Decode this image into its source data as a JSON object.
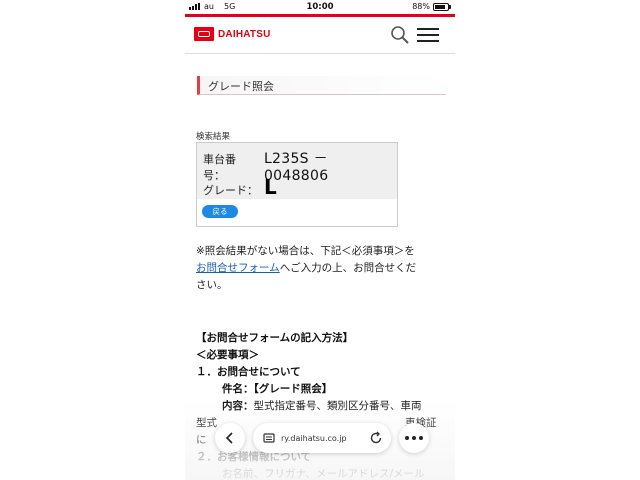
{
  "status_bar": {
    "carrier": "au",
    "network": "5G",
    "time": "10:00",
    "battery": "88%"
  },
  "header": {
    "logo_text": "DAIHATSU",
    "icons": [
      "search-icon",
      "menu-icon"
    ]
  },
  "section": {
    "title": "グレード照会"
  },
  "result": {
    "label": "検索結果",
    "chassis_label": "車台番号：",
    "chassis_value": "L235S － 0048806",
    "grade_label": "グレード：",
    "grade_value": "L",
    "back_button": "戻る"
  },
  "note": {
    "line1": "※照会結果がない場合は、下記＜必須事項＞を",
    "link": "お問合せフォーム",
    "line2": "へご入力の上、お問合せくだ",
    "line3": "さい。"
  },
  "howto": {
    "heading": "【お問合せフォームの記入方法】",
    "required": "＜必要事項＞",
    "item1": "１．お問合せについて",
    "subject": "件名：【グレード照会】",
    "content_label": "内容：",
    "content_text": "型式指定番号、類別区分番号、車両",
    "line_partial1": "型式",
    "line_partial2": "に",
    "line_partial3": "車検証",
    "item2": "２．お客様情報について",
    "item2_detail": "お名前、フリガナ、メールアドレス/メール"
  },
  "toolbar": {
    "url": "ry.daihatsu.co.jp",
    "icons": [
      "back-chevron-icon",
      "reader-icon",
      "reload-icon",
      "more-icon"
    ]
  },
  "colors": {
    "brand_red": "#e60012",
    "link_blue": "#1a5fb4",
    "button_blue": "#1e88e5"
  }
}
